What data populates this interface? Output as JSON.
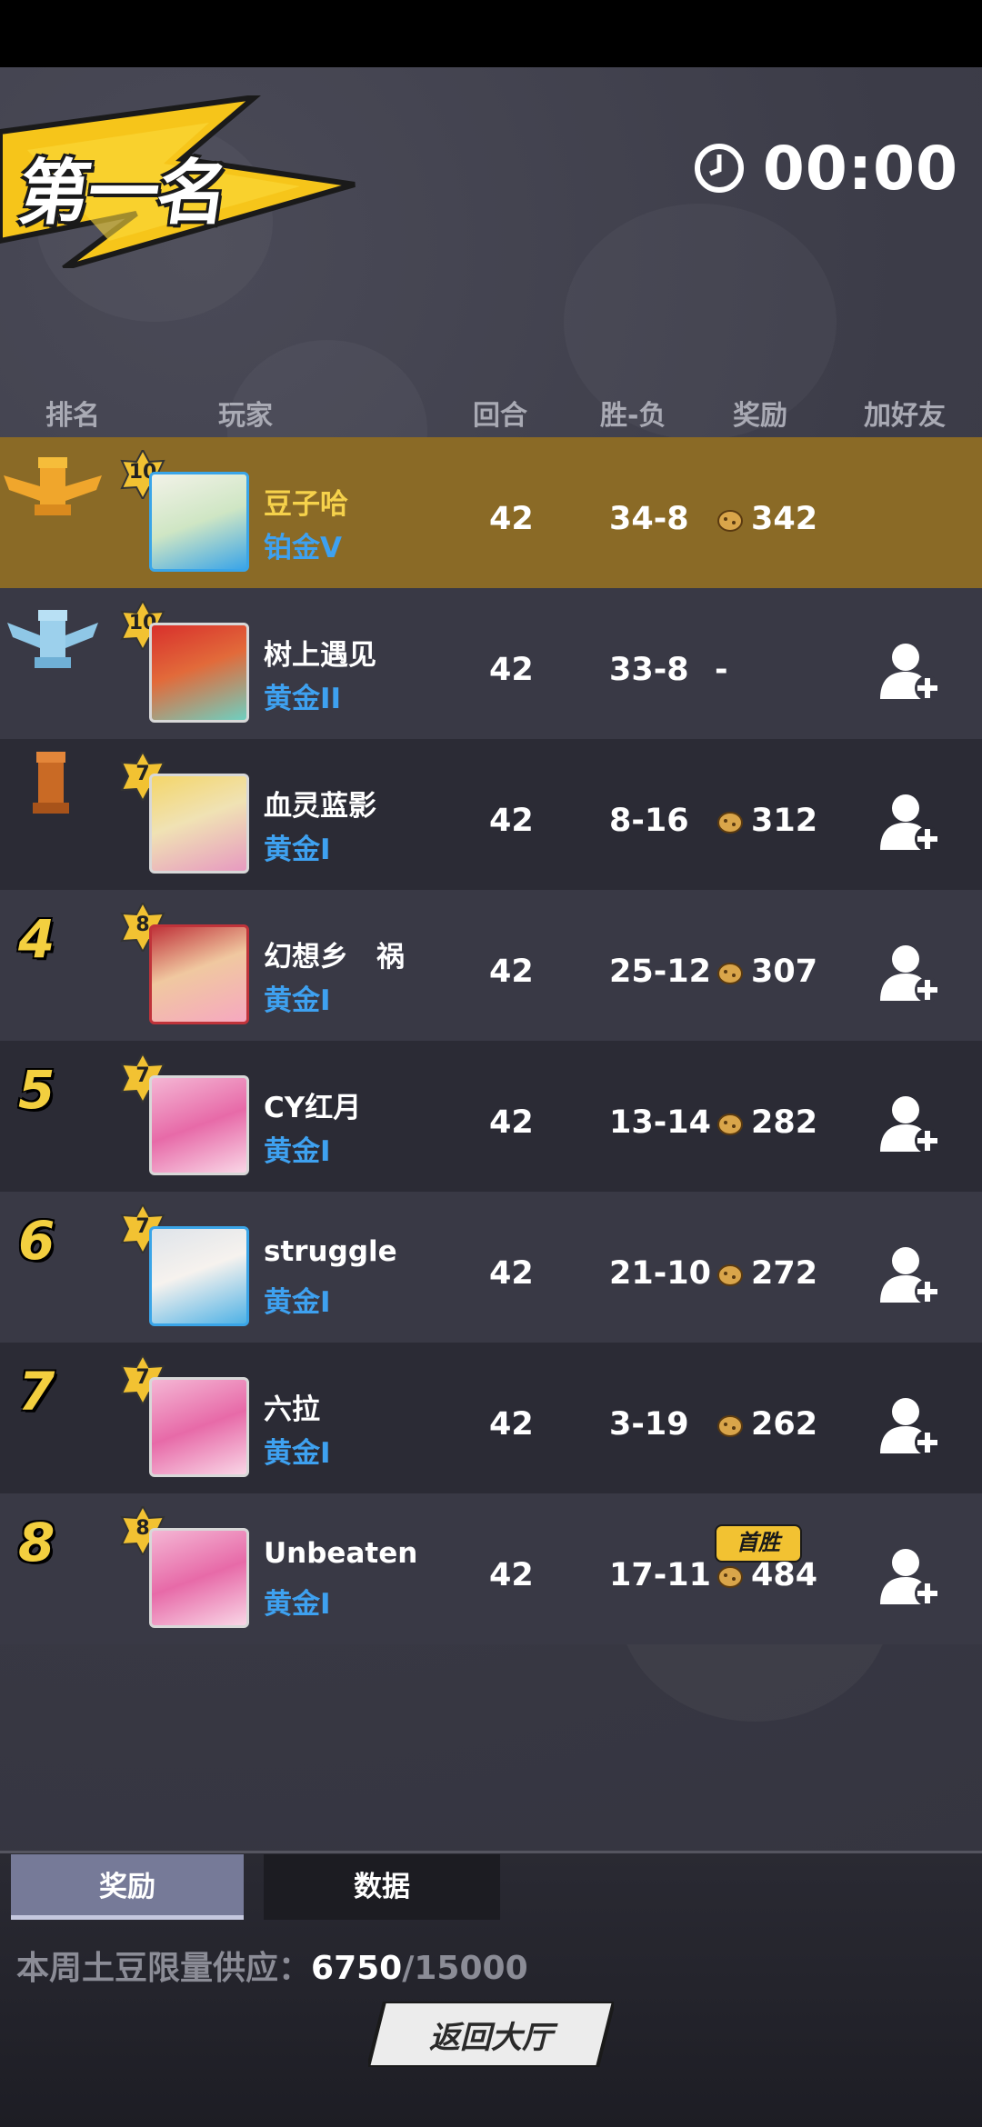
{
  "title": "第一名",
  "timer": "00:00",
  "columns": {
    "rank": "排名",
    "player": "玩家",
    "round": "回合",
    "wl": "胜-负",
    "reward": "奖励",
    "add": "加好友"
  },
  "players": [
    {
      "rank": "1",
      "level": "10",
      "name": "豆子哈",
      "tier": "铂金V",
      "round": "42",
      "wl": "34-8",
      "reward": "342",
      "first_win": ""
    },
    {
      "rank": "2",
      "level": "10",
      "name": "树上遇见",
      "tier": "黄金II",
      "round": "42",
      "wl": "33-8",
      "reward": "-",
      "first_win": ""
    },
    {
      "rank": "3",
      "level": "7",
      "name": "血灵蓝影",
      "tier": "黄金I",
      "round": "42",
      "wl": "8-16",
      "reward": "312",
      "first_win": ""
    },
    {
      "rank": "4",
      "level": "8",
      "name": "幻想乡　祸",
      "tier": "黄金I",
      "round": "42",
      "wl": "25-12",
      "reward": "307",
      "first_win": ""
    },
    {
      "rank": "5",
      "level": "7",
      "name": "CY红月",
      "tier": "黄金I",
      "round": "42",
      "wl": "13-14",
      "reward": "282",
      "first_win": ""
    },
    {
      "rank": "6",
      "level": "7",
      "name": "struggle",
      "tier": "黄金I",
      "round": "42",
      "wl": "21-10",
      "reward": "272",
      "first_win": ""
    },
    {
      "rank": "7",
      "level": "7",
      "name": "六拉",
      "tier": "黄金I",
      "round": "42",
      "wl": "3-19",
      "reward": "262",
      "first_win": ""
    },
    {
      "rank": "8",
      "level": "8",
      "name": "Unbeaten",
      "tier": "黄金I",
      "round": "42",
      "wl": "17-11",
      "reward": "484",
      "first_win": "首胜"
    }
  ],
  "tabs": {
    "reward": "奖励",
    "data": "数据"
  },
  "supply": {
    "label": "本周土豆限量供应：",
    "current": "6750",
    "max": "/15000"
  },
  "back_button": "返回大厅",
  "colors": {
    "gold_row": "#8a6a26",
    "tier_blue": "#3ea1f0",
    "rank_yellow": "#f3cf3f"
  }
}
